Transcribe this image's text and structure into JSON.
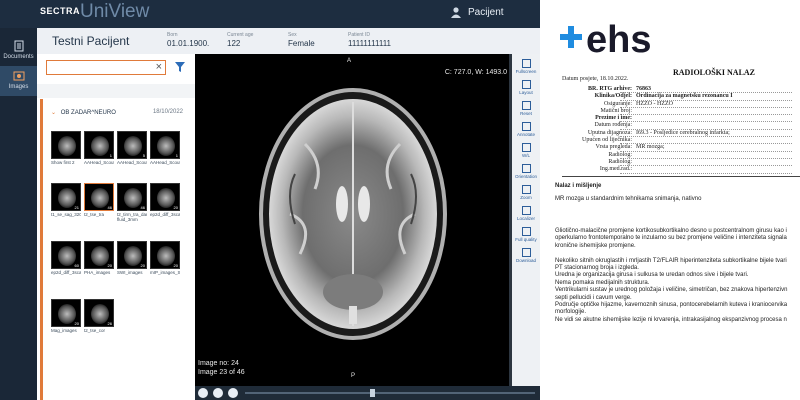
{
  "app": {
    "brand": "SECTRA",
    "product": "UniView",
    "user": "Pacijent"
  },
  "nav": {
    "documents": "Documents",
    "images": "Images"
  },
  "patient": {
    "name": "Testni Pacijent",
    "born_label": "Born",
    "born": "01.01.1900.",
    "age_label": "Current age",
    "age": "122",
    "sex_label": "Sex",
    "sex": "Female",
    "id_label": "Patient ID",
    "id": "11111111111"
  },
  "study": {
    "title": "OB ZADAR^NEURO",
    "date": "18/10/2022"
  },
  "thumbnails": [
    {
      "label": "Show first 2",
      "count": ""
    },
    {
      "label": "AAHead_Scout_MPR_cor",
      "count": "1"
    },
    {
      "label": "AAHead_Scout_MPR_sag",
      "count": "5"
    },
    {
      "label": "AAHead_Scout_MPR_tra",
      "count": "1"
    },
    {
      "label": "t1_se_sag_320",
      "count": "21"
    },
    {
      "label": "t2_tse_tra",
      "count": "46"
    },
    {
      "label": "t2_tirm_tra_dark-fluid_3mm",
      "count": "46"
    },
    {
      "label": "ep2d_diff_3scan_trace_p2_ADC",
      "count": "20"
    },
    {
      "label": "ep2d_diff_3scan_trace_p2_TRACEW",
      "count": "60"
    },
    {
      "label": "PHA_images",
      "count": "20"
    },
    {
      "label": "SWI_images",
      "count": "20"
    },
    {
      "label": "mIP_images_SWI",
      "count": "20"
    },
    {
      "label": "Mag_images",
      "count": "20"
    },
    {
      "label": "t2_tse_cor",
      "count": "26"
    }
  ],
  "viewer": {
    "cw": "C: 727.0, W: 1493.0",
    "orient_top": "A",
    "orient_bottom": "P",
    "image_no": "Image no: 24",
    "image_of": "Image 23 of 46"
  },
  "toolbar": [
    "Fullscreen",
    "Layout",
    "Reset",
    "Annotate",
    "W/L",
    "Orientation",
    "Zoom",
    "Localizer",
    "Full quality",
    "Download"
  ],
  "report": {
    "logo_text": "ehs",
    "date_line": "Datum posjete, 18.10.2022.",
    "title": "RADIOLOŠKI NALAZ",
    "fields": [
      {
        "k": "BR. RTG arhive:",
        "v": "76863",
        "kb": true,
        "vb": true
      },
      {
        "k": "Klinika/Odjel:",
        "v": "Ordinacija za magnetsku rezonancu I",
        "kb": true,
        "vb": true
      },
      {
        "k": "Osiguranje:",
        "v": "HZZO - HZZO",
        "kb": false,
        "vb": false
      },
      {
        "k": "Matični broj:",
        "v": "",
        "kb": false,
        "vb": false
      },
      {
        "k": "Prezime i ime:",
        "v": "",
        "kb": true,
        "vb": false
      },
      {
        "k": "Datum rođenja:",
        "v": "",
        "kb": false,
        "vb": false
      },
      {
        "k": "Uputna dijagnoza:",
        "v": "I69.3 - Posljedice cerebralnog infarkta;",
        "kb": false,
        "vb": false
      },
      {
        "k": "Upućen od liječnika:",
        "v": "",
        "kb": false,
        "vb": false
      },
      {
        "k": "Vrsta pregleda:",
        "v": "MR mozga;",
        "kb": false,
        "vb": false
      },
      {
        "k": "Radiolog:",
        "v": "",
        "kb": false,
        "vb": false
      },
      {
        "k": "Radiolog:",
        "v": "",
        "kb": false,
        "vb": false
      },
      {
        "k": "Ing.med.rad.:",
        "v": "",
        "kb": false,
        "vb": false
      }
    ],
    "section_title": "Nalaz i mišljenje",
    "para1": "MR mozga u standardnim tehnikama snimanja, nativno",
    "lines": [
      "Gliotično-malacične promjene kortikosubkortikalno desno u postcentralnom girusu kao i",
      "operkularno frontotemporalno te inzularno su bez promjene veličine i intenziteta signala",
      "kronične ishemijske promjene.",
      "",
      "Nekoliko sitnih okruglastih i mrljastih T2/FLAIR hiperintenziteta subkortikalne bijele tvari",
      "PT stacionarnog broja i izgleda.",
      "Uredna je organizacija girusa i sulkusa te uredan odnos sive i bijele tvari.",
      "Nema pomaka medijalnih struktura.",
      "Ventrikularni sustav je urednog položaja i veličine, simetričan, bez znakova hipertenzivn",
      "septi pellucidi i cavum verge.",
      "Područje optičke hijazme, kavernoznih sinusa, pontocerebelarnih kuteva i kraniocervika",
      "morfologije.",
      "Ne vidi se akutne ishemijske lezije ni krvarenja, intrakasijalnog ekspanzivnog procesa n"
    ]
  }
}
